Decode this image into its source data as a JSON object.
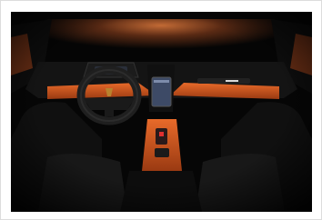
{
  "image": {
    "subject": "car-interior-dashboard",
    "palette": {
      "background": "#050505",
      "accent_orange": "#d2561e",
      "ambient_glow": "#b8582a",
      "screen_blue": "#3d4a66",
      "leather_black": "#121212"
    },
    "icons": [
      "steering-wheel-logo",
      "center-touchscreen",
      "start-button-cover"
    ]
  }
}
